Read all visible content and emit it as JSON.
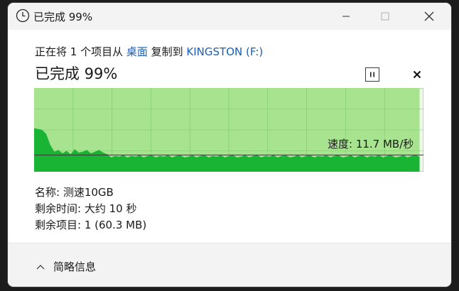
{
  "window": {
    "title": "已完成 99%",
    "icon": "clock-icon"
  },
  "window_controls": {
    "minimize_icon": "minimize-icon",
    "maximize_icon": "maximize-icon",
    "close_icon": "close-icon"
  },
  "copy": {
    "prefix": "正在将 1 个项目从 ",
    "source": "桌面",
    "middle": " 复制到 ",
    "destination": "KINGSTON (F:)",
    "progress_text": "已完成 99%",
    "progress_percent": 99,
    "speed_label": "速度: 11.7 MB/秒"
  },
  "controls": {
    "pause_icon": "pause-icon",
    "stop_icon": "stop-icon"
  },
  "details": {
    "name": "名称: 测速10GB",
    "time_remaining": "剩余时间: 大约 10 秒",
    "items_remaining": "剩余项目: 1 (60.3 MB)"
  },
  "footer": {
    "toggle_label": "简略信息",
    "toggle_icon": "chevron-up-icon"
  },
  "colors": {
    "progress_fill": "#a8e490",
    "speed_fill": "#1ab435",
    "speed_line": "#333333",
    "grid": "#7bc96a",
    "link": "#1a5fb4"
  },
  "chart_data": {
    "type": "area",
    "progress_percent": 99,
    "current_speed_mb_s": 11.7,
    "speed_samples_relative": [
      0.52,
      0.51,
      0.5,
      0.45,
      0.32,
      0.24,
      0.26,
      0.22,
      0.25,
      0.21,
      0.27,
      0.23,
      0.24,
      0.26,
      0.22,
      0.24,
      0.26,
      0.23,
      0.21,
      0.17,
      0.19,
      0.18,
      0.2,
      0.17,
      0.19,
      0.18,
      0.2,
      0.17,
      0.19,
      0.2,
      0.17,
      0.19,
      0.18,
      0.2,
      0.17,
      0.19,
      0.2,
      0.17,
      0.18,
      0.2,
      0.17,
      0.19,
      0.2,
      0.17,
      0.19,
      0.18,
      0.2,
      0.17,
      0.19,
      0.2,
      0.17,
      0.18,
      0.2,
      0.17,
      0.19,
      0.2,
      0.17,
      0.19,
      0.18,
      0.2,
      0.17,
      0.19,
      0.2,
      0.17,
      0.18,
      0.2,
      0.17,
      0.19,
      0.2,
      0.17,
      0.19,
      0.18,
      0.2,
      0.17,
      0.19,
      0.2,
      0.17,
      0.18,
      0.2,
      0.17,
      0.19,
      0.2,
      0.17,
      0.19,
      0.18,
      0.2,
      0.17,
      0.19,
      0.2,
      0.17,
      0.18,
      0.2,
      0.17,
      0.19,
      0.2,
      0.18
    ]
  }
}
